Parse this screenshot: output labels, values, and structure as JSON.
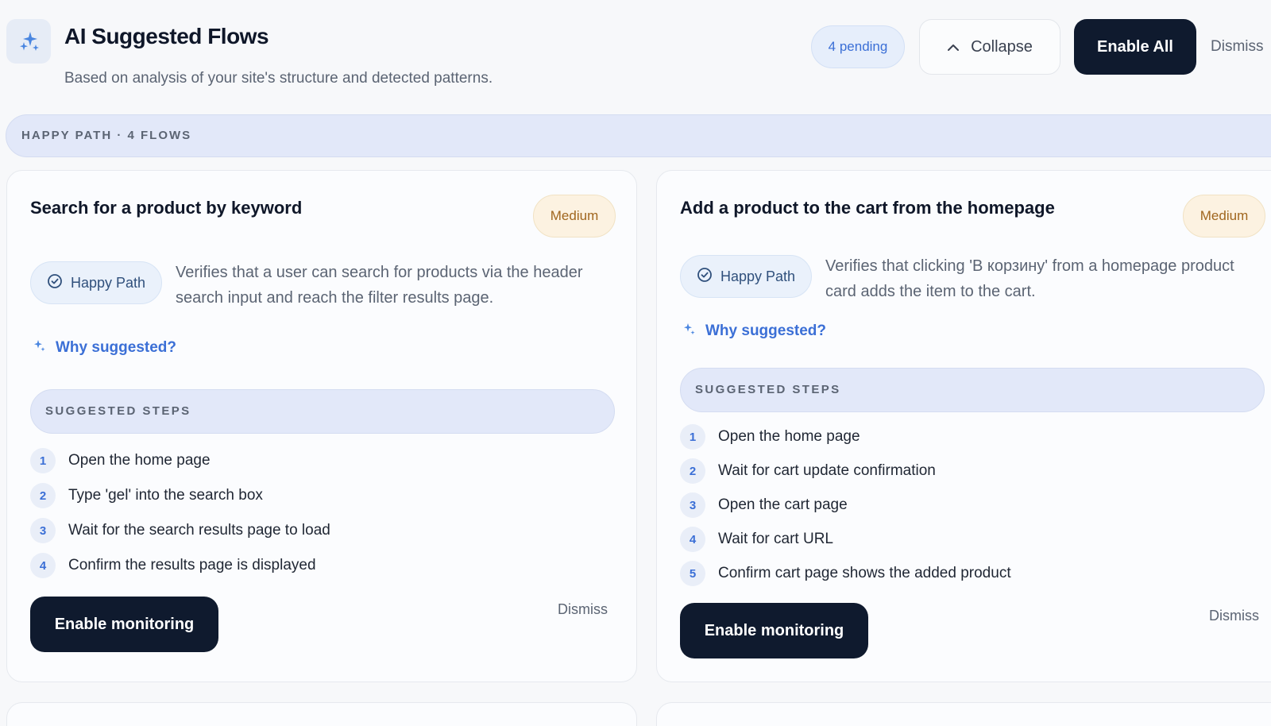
{
  "header": {
    "title": "AI Suggested Flows",
    "subtitle": "Based on analysis of your site's structure and detected patterns.",
    "pending_badge": "4 pending",
    "collapse_label": "Collapse",
    "enable_all_label": "Enable All",
    "dismiss_all_label": "Dismiss"
  },
  "group": {
    "label": "HAPPY PATH · 4 FLOWS"
  },
  "cards": [
    {
      "title": "Search for a product by keyword",
      "difficulty": "Medium",
      "type": "Happy Path",
      "description": "Verifies that a user can search for products via the header search input and reach the filter results page.",
      "why_label": "Why suggested?",
      "steps_header": "SUGGESTED STEPS",
      "steps": [
        {
          "num": "1",
          "text": "Open the home page"
        },
        {
          "num": "2",
          "text": "Type 'gel' into the search box"
        },
        {
          "num": "3",
          "text": "Wait for the search results page to load"
        },
        {
          "num": "4",
          "text": "Confirm the results page is displayed"
        }
      ],
      "enable_label": "Enable monitoring",
      "dismiss_label": "Dismiss"
    },
    {
      "title": "Add a product to the cart from the homepage",
      "difficulty": "Medium",
      "type": "Happy Path",
      "description": "Verifies that clicking 'В корзину' from a homepage product card adds the item to the cart.",
      "why_label": "Why suggested?",
      "steps_header": "SUGGESTED STEPS",
      "steps": [
        {
          "num": "1",
          "text": "Open the home page"
        },
        {
          "num": "2",
          "text": "Wait for cart update confirmation"
        },
        {
          "num": "3",
          "text": "Open the cart page"
        },
        {
          "num": "4",
          "text": "Wait for cart URL"
        },
        {
          "num": "5",
          "text": "Confirm cart page shows the added product"
        }
      ],
      "enable_label": "Enable monitoring",
      "dismiss_label": "Dismiss"
    }
  ],
  "icons": {
    "logo": "sparkles-icon",
    "collapse": "chevron-up-icon",
    "type": "check-circle-icon",
    "why": "sparkle-icon"
  },
  "colors": {
    "primary_dark": "#0f1a2e",
    "accent_blue": "#3b6fd6",
    "medium_badge_bg": "#fcf2e1",
    "medium_badge_text": "#a0661e",
    "group_bar_bg": "#e2e8f9"
  }
}
